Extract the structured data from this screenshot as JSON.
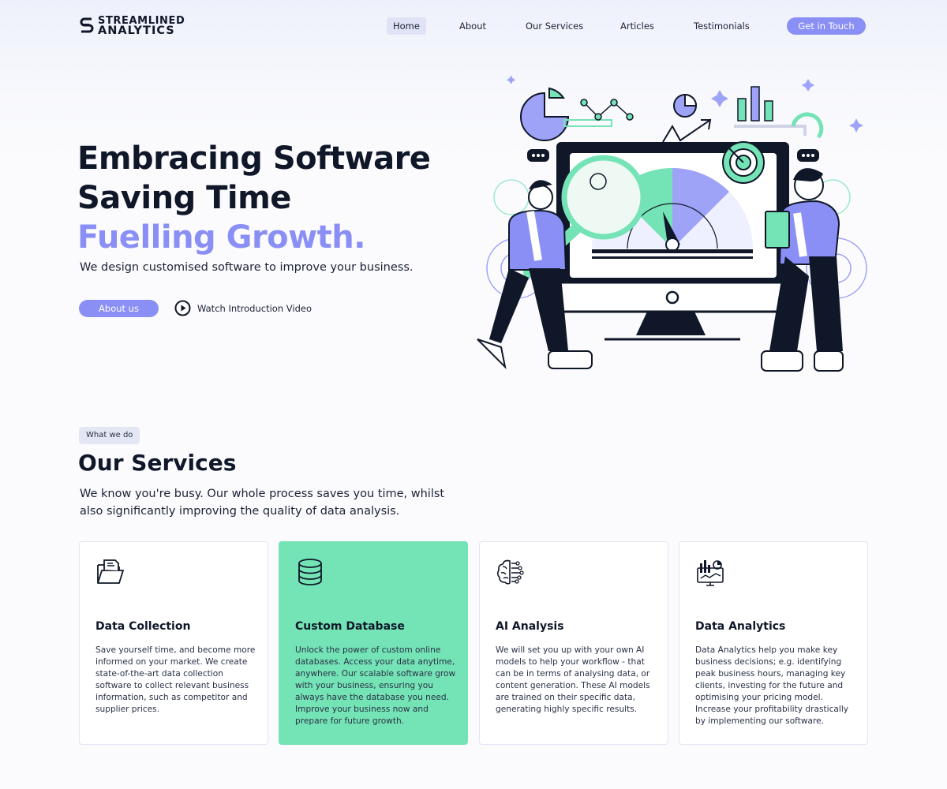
{
  "brand": {
    "logo_line1": "STREAMLINED",
    "logo_line2": "ANALYTICS",
    "accent_color": "#8a8ff5",
    "green_color": "#74e3b5",
    "text_color": "#0f1729"
  },
  "nav": {
    "items": [
      {
        "label": "Home",
        "active": true
      },
      {
        "label": "About",
        "active": false
      },
      {
        "label": "Our Services",
        "active": false
      },
      {
        "label": "Articles",
        "active": false
      },
      {
        "label": "Testimonials",
        "active": false
      }
    ],
    "cta_label": "Get in Touch"
  },
  "hero": {
    "title_line1": "Embracing Software",
    "title_line2": "Saving Time",
    "title_line3": "Fuelling Growth.",
    "subtitle": "We design customised software to improve your business.",
    "about_button": "About us",
    "video_link": "Watch Introduction Video",
    "icons": {
      "video": "play-circle-icon"
    }
  },
  "services": {
    "badge": "What we do",
    "title": "Our Services",
    "description": "We know you're busy. Our whole process saves you time, whilst also significantly improving the quality of data analysis.",
    "cards": [
      {
        "icon": "folder-documents-icon",
        "title": "Data Collection",
        "text": "Save yourself time, and become more informed on your market. We create state-of-the-art data collection software to collect relevant business information, such as competitor and supplier prices.",
        "highlighted": false
      },
      {
        "icon": "database-icon",
        "title": "Custom Database",
        "text": "Unlock the power of custom online databases. Access your data anytime, anywhere. Our scalable software grow with your business, ensuring you always have the database you need. Improve your business now and prepare for future growth.",
        "highlighted": true
      },
      {
        "icon": "ai-brain-icon",
        "title": "AI Analysis",
        "text": "We will set you up with your own AI models to help your workflow - that can be in terms of analysing data, or content generation. These AI models are trained on their specific data, generating highly specific results.",
        "highlighted": false
      },
      {
        "icon": "analytics-monitor-icon",
        "title": "Data Analytics",
        "text": "Data Analytics help you make key business decisions; e.g. identifying peak business hours, managing key clients, investing for the future and optimising your pricing model. Increase your profitability drastically by implementing our software.",
        "highlighted": false
      }
    ]
  }
}
